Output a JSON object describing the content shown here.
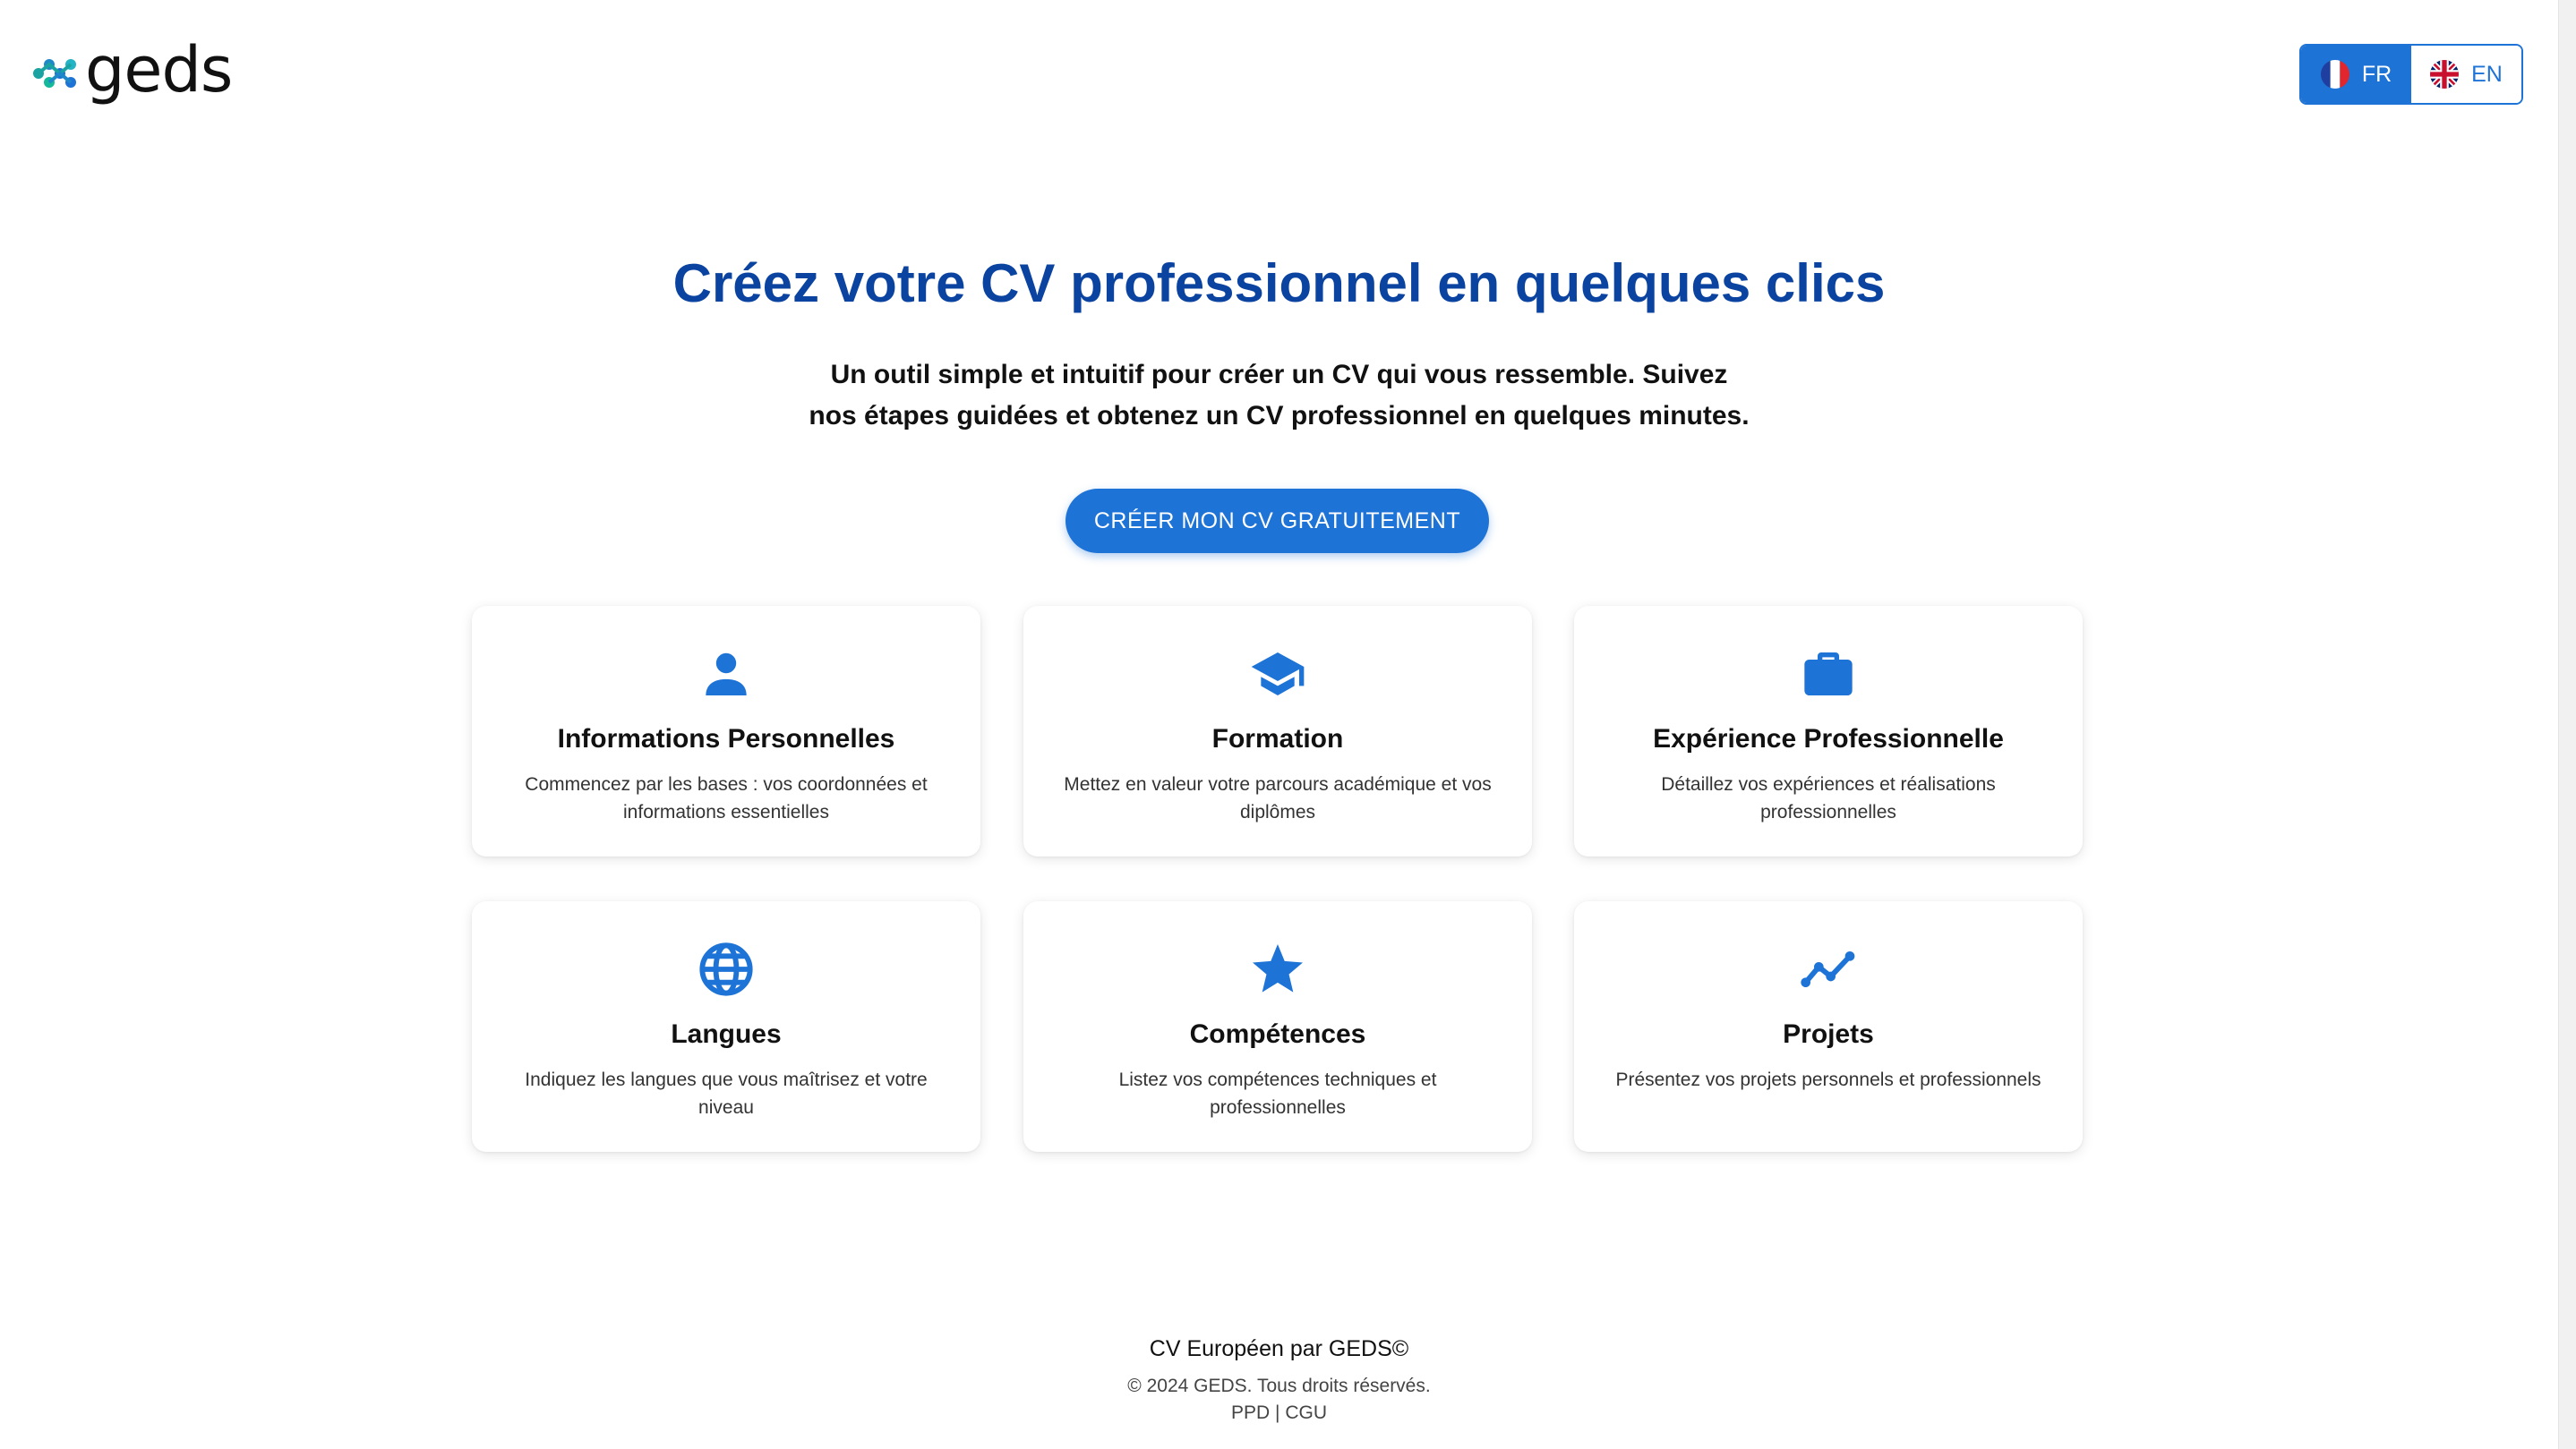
{
  "header": {
    "logo_text": "geds",
    "languages": [
      {
        "code": "FR",
        "active": true
      },
      {
        "code": "EN",
        "active": false
      }
    ]
  },
  "hero": {
    "title": "Créez votre CV professionnel en quelques clics",
    "subtitle": "Un outil simple et intuitif pour créer un CV qui vous ressemble. Suivez nos étapes guidées et obtenez un CV professionnel en quelques minutes.",
    "cta_label": "CRÉER MON CV GRATUITEMENT"
  },
  "cards": [
    {
      "icon": "person-icon",
      "title": "Informations Personnelles",
      "description": "Commencez par les bases : vos coordonnées et informations essentielles"
    },
    {
      "icon": "graduation-cap-icon",
      "title": "Formation",
      "description": "Mettez en valeur votre parcours académique et vos diplômes"
    },
    {
      "icon": "briefcase-icon",
      "title": "Expérience Professionnelle",
      "description": "Détaillez vos expériences et réalisations professionnelles"
    },
    {
      "icon": "globe-icon",
      "title": "Langues",
      "description": "Indiquez les langues que vous maîtrisez et votre niveau"
    },
    {
      "icon": "star-icon",
      "title": "Compétences",
      "description": "Listez vos compétences techniques et professionnelles"
    },
    {
      "icon": "trend-line-icon",
      "title": "Projets",
      "description": "Présentez vos projets personnels et professionnels"
    }
  ],
  "footer": {
    "line1": "CV Européen par GEDS©",
    "line2": "© 2024 GEDS. Tous droits réservés.",
    "link_ppd": "PPD",
    "separator": "|",
    "link_cgu": "CGU"
  },
  "colors": {
    "primary": "#1e73d6",
    "title": "#0b43a0"
  }
}
